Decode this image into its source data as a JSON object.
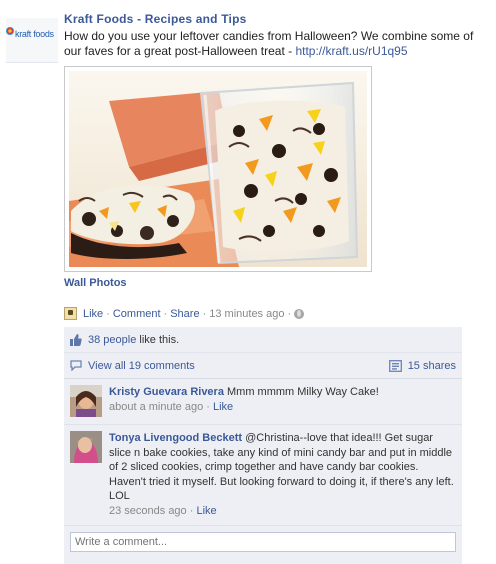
{
  "page": {
    "logo_text": "kraft foods",
    "name": "Kraft Foods - Recipes and Tips"
  },
  "post": {
    "message": "How do you use your leftover candies from Halloween? We combine some of our faves for a great post-Halloween treat - ",
    "link_text": "http://kraft.us/rU1q95",
    "album": "Wall Photos",
    "actions": {
      "like": "Like",
      "comment": "Comment",
      "share": "Share",
      "time": "13 minutes ago"
    }
  },
  "ufi": {
    "likes_link": "38 people",
    "likes_suffix": " like this.",
    "view_comments": "View all 19 comments",
    "shares": "15 shares",
    "comments": [
      {
        "author": "Kristy Guevara Rivera",
        "text": "Mmm mmmm Milky Way Cake!",
        "time": "about a minute ago",
        "like": "Like"
      },
      {
        "author": "Tonya Livengood Beckett",
        "text": "@Christina--love that idea!!! Get sugar slice n bake cookies, take any kind of mini candy bar and put in middle of 2 sliced cookies, crimp together and have candy bar cookies. Haven't tried it myself. But looking forward to doing it, if there's any left. LOL",
        "time": "23 seconds ago",
        "like": "Like"
      }
    ],
    "write_placeholder": "Write a comment..."
  },
  "icons": {
    "like_thumb": "thumbs-up-icon",
    "comment_bubble": "comment-bubble-icon",
    "share": "share-icon",
    "privacy": "globe-icon",
    "page_badge": "page-icon"
  },
  "colors": {
    "link": "#3b5998",
    "ufi_bg": "#edeff4"
  }
}
